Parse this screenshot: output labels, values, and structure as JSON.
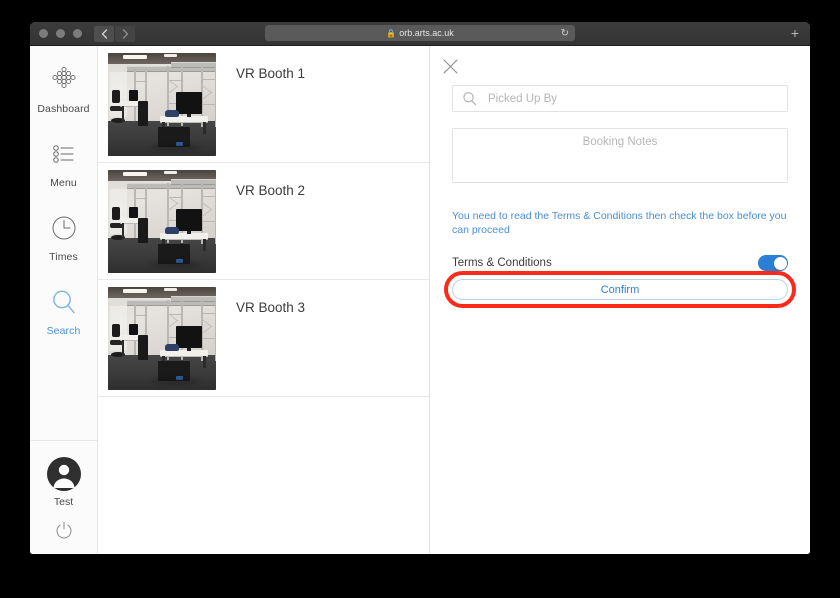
{
  "browser": {
    "url": "orb.arts.ac.uk",
    "lock_icon": "lock-icon",
    "reload_icon": "reload-icon",
    "back_icon": "chevron-left-icon",
    "forward_icon": "chevron-right-icon",
    "newtab_label": "+"
  },
  "sidebar": {
    "items": [
      {
        "label": "Dashboard",
        "icon": "dashboard-grid-icon",
        "active": false
      },
      {
        "label": "Menu",
        "icon": "list-menu-icon",
        "active": false
      },
      {
        "label": "Times",
        "icon": "clock-icon",
        "active": false
      },
      {
        "label": "Search",
        "icon": "search-icon",
        "active": true
      }
    ],
    "user": {
      "name": "Test",
      "avatar_icon": "person-avatar-icon",
      "power_icon": "power-icon"
    }
  },
  "list": {
    "rows": [
      {
        "title": "VR Booth 1",
        "thumb_alt": "vr-booth-photo"
      },
      {
        "title": "VR Booth 2",
        "thumb_alt": "vr-booth-photo"
      },
      {
        "title": "VR Booth 3",
        "thumb_alt": "vr-booth-photo"
      }
    ]
  },
  "detail": {
    "close_icon": "close-x-icon",
    "picked_up_by": {
      "placeholder": "Picked Up By",
      "value": "",
      "icon": "search-icon"
    },
    "booking_notes": {
      "placeholder": "Booking Notes",
      "value": ""
    },
    "warning": "You need to read the Terms & Conditions then check the box before you can proceed",
    "terms_label": "Terms & Conditions",
    "terms_toggle_on": true,
    "confirm_label": "Confirm"
  },
  "colors": {
    "accent_blue": "#2b7fd4",
    "link_blue": "#4a8fd4",
    "annotation_red": "#fc2a1a",
    "toggle_on": "#2b7fd4",
    "sidebar_bg": "#fbfbfb",
    "page_bg": "#000000"
  }
}
